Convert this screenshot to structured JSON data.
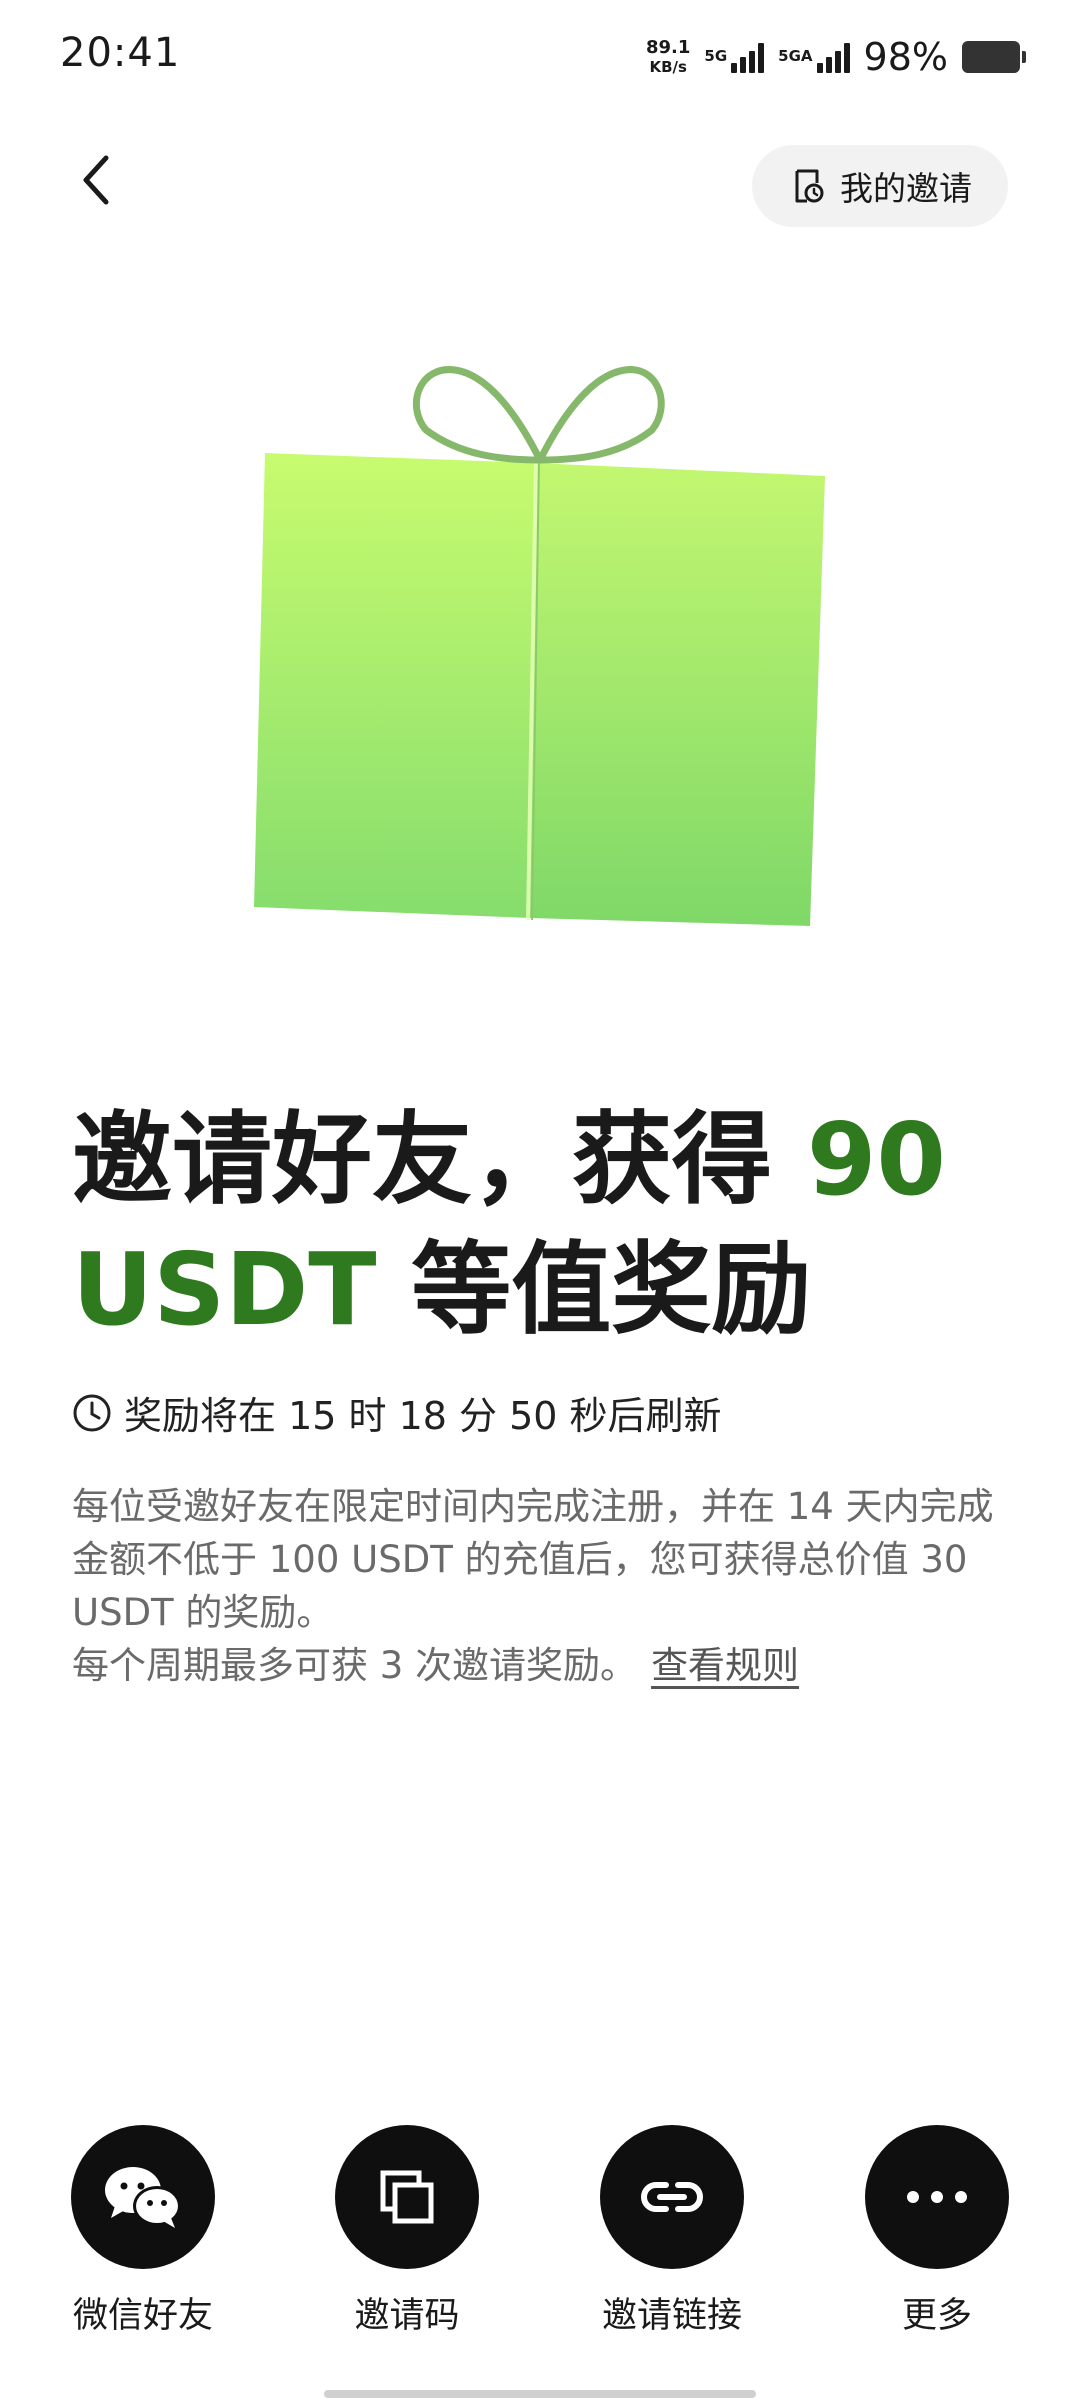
{
  "status_bar": {
    "time": "20:41",
    "net_speed_value": "89.1",
    "net_speed_unit": "KB/s",
    "sim1_label": "5G",
    "sim2_label": "5GA",
    "battery_percent": "98%"
  },
  "nav": {
    "my_invites_label": "我的邀请"
  },
  "hero": {
    "title_part1": "邀请好友，获得 ",
    "title_highlight": "90 USDT",
    "title_part2": " 等值奖励",
    "refresh_text": "奖励将在 15 时 18 分 50 秒后刷新",
    "description": "每位受邀好友在限定时间内完成注册，并在 14 天内完成金额不低于 100 USDT 的充值后，您可获得总价值 30 USDT 的奖励。",
    "cycle_text": "每个周期最多可获 3 次邀请奖励。",
    "rules_link": "查看规则"
  },
  "share_options": [
    {
      "label": "微信好友",
      "icon": "wechat-icon"
    },
    {
      "label": "邀请码",
      "icon": "copy-icon"
    },
    {
      "label": "邀请链接",
      "icon": "link-icon"
    },
    {
      "label": "更多",
      "icon": "more-icon"
    }
  ],
  "colors": {
    "accent_green": "#2f7a1e",
    "gift_top": "#c8fb6f",
    "gift_bottom": "#7fd96a",
    "ribbon": "#86b86b"
  }
}
